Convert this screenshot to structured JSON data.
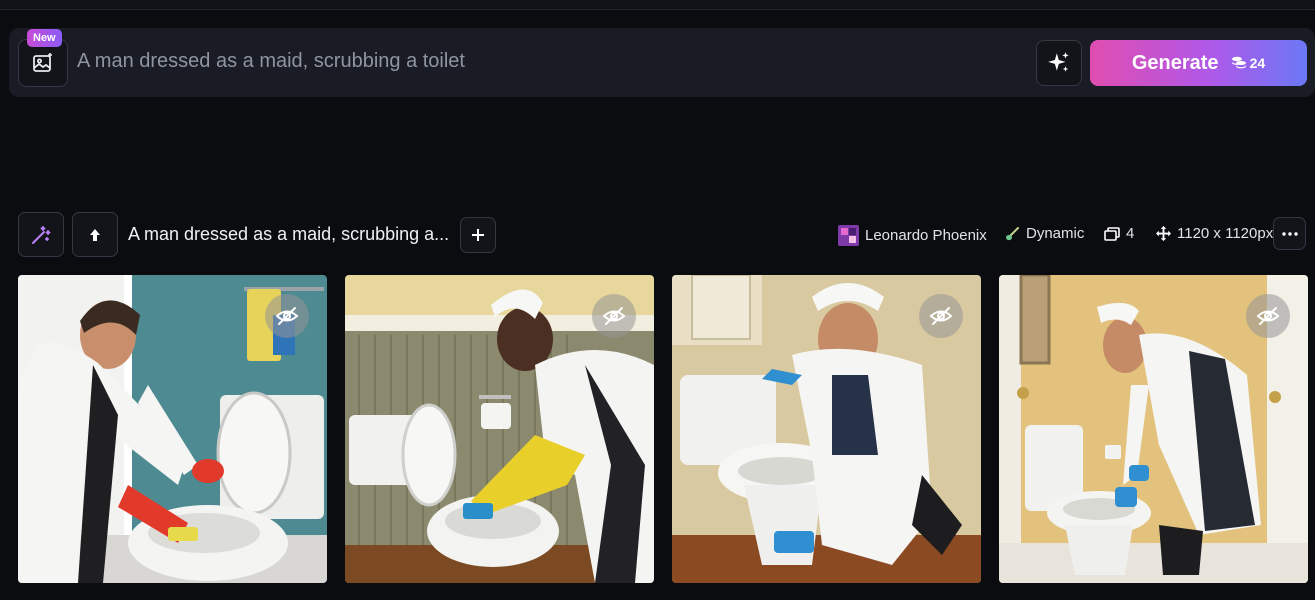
{
  "prompt_bar": {
    "new_badge": "New",
    "prompt_text": "A man dressed as a maid, scrubbing a toilet",
    "generate_label": "Generate",
    "token_count": "24"
  },
  "generation": {
    "title": "A man dressed as a maid, scrubbing a...",
    "model": "Leonardo Phoenix",
    "style": "Dynamic",
    "image_count": "4",
    "dimensions": "1120 x 1120px"
  },
  "images": [
    {
      "description": "maid-man scrubbing toilet, teal wall"
    },
    {
      "description": "maid-man scrubbing toilet, beige paneled wall"
    },
    {
      "description": "maid-man kneeling by toilet, smiling"
    },
    {
      "description": "maid-man cleaning toilet seat, yellow wall"
    }
  ],
  "colors": {
    "background": "#0b0c10",
    "panel": "#191c24",
    "generate_gradient_start": "#e04db0",
    "generate_gradient_end": "#6b78f5"
  }
}
